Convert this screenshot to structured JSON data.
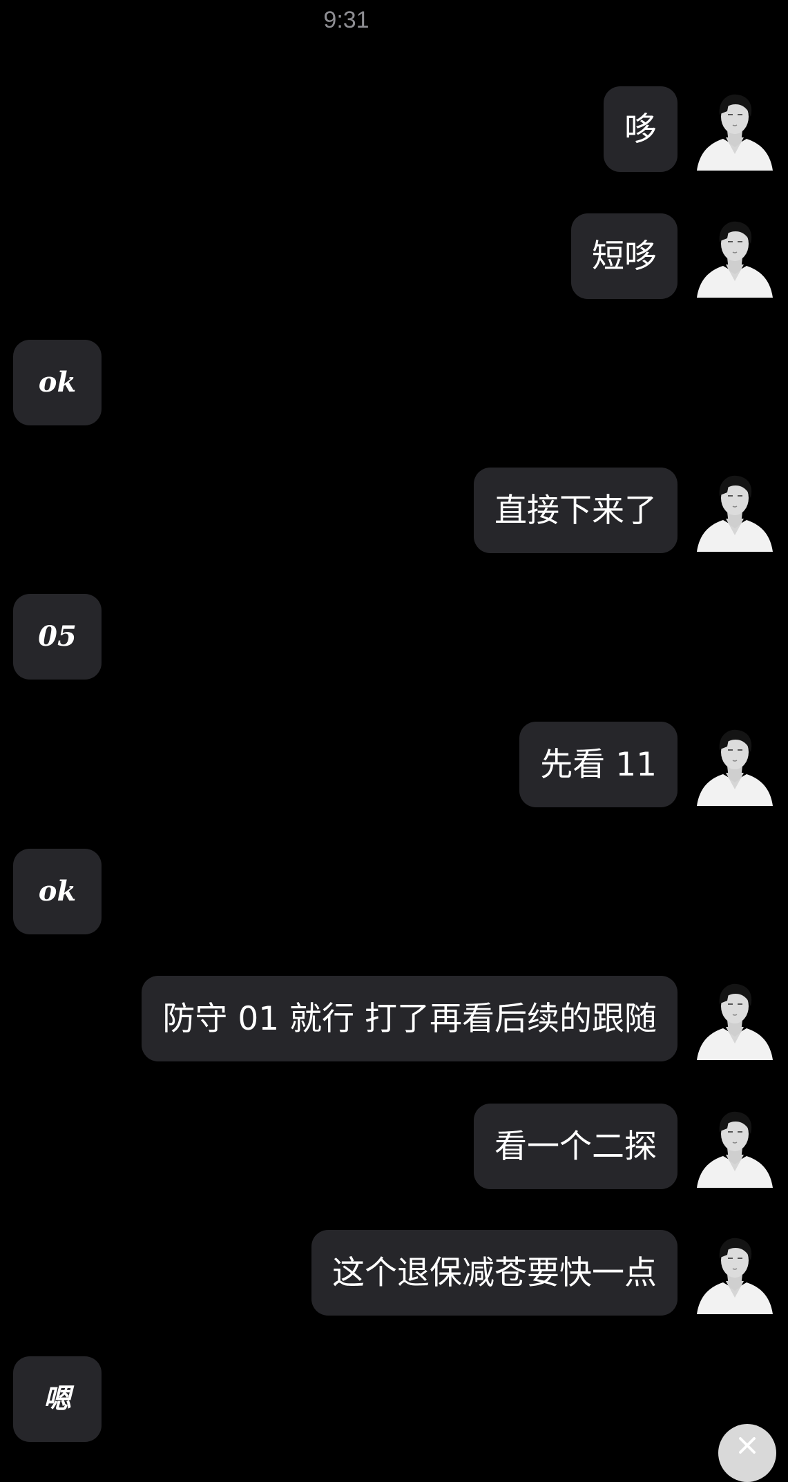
{
  "status_time": "9:31",
  "messages": [
    {
      "side": "sent",
      "text": "哆"
    },
    {
      "side": "sent",
      "text": "短哆"
    },
    {
      "side": "recv",
      "text": "ok"
    },
    {
      "side": "sent",
      "text": "直接下来了"
    },
    {
      "side": "recv",
      "text": "05"
    },
    {
      "side": "sent",
      "text": "先看 11"
    },
    {
      "side": "recv",
      "text": "ok"
    },
    {
      "side": "sent",
      "text": "防守 01 就行 打了再看后续的跟随"
    },
    {
      "side": "sent",
      "text": "看一个二探"
    },
    {
      "side": "sent",
      "text": "这个退保减苍要快一点"
    },
    {
      "side": "recv",
      "text": "嗯"
    }
  ],
  "icons": {
    "avatar": "user-avatar-portrait",
    "close": "close-icon"
  },
  "colors": {
    "background": "#000000",
    "bubble": "#26262a",
    "text": "#ffffff",
    "timestamp": "#8e8e93"
  }
}
